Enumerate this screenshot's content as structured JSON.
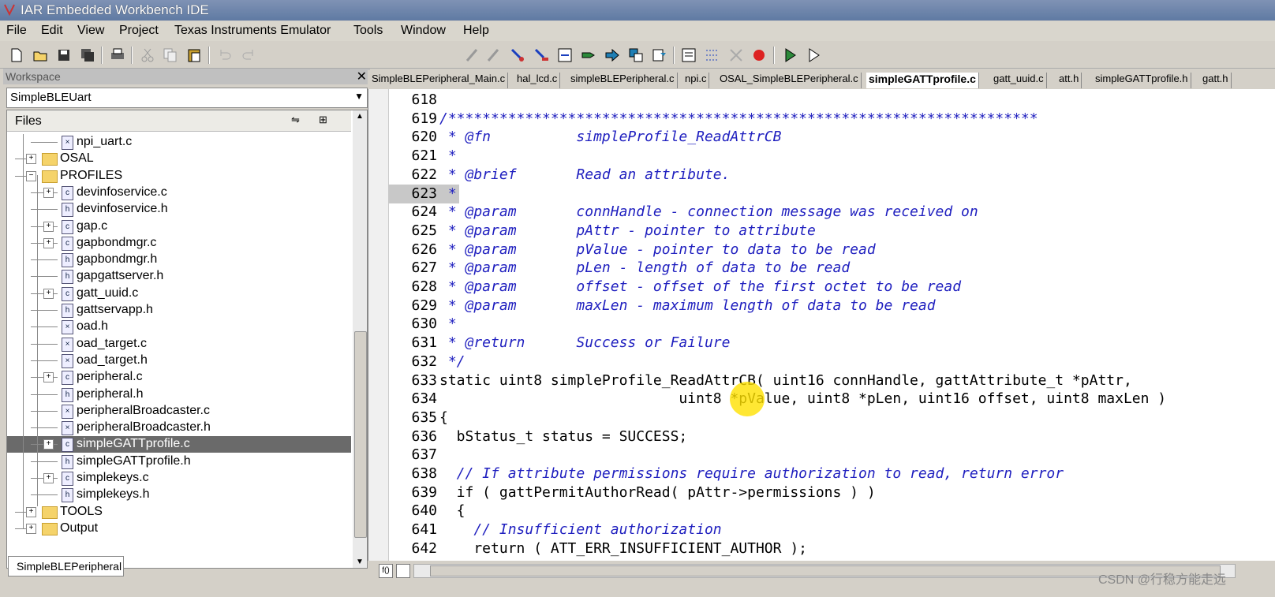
{
  "window": {
    "title": "IAR Embedded Workbench IDE"
  },
  "menu": [
    "File",
    "Edit",
    "View",
    "Project",
    "Texas Instruments Emulator",
    "Tools",
    "Window",
    "Help"
  ],
  "workspace": {
    "header": "Workspace",
    "project": "SimpleBLEUart",
    "files_label": "Files",
    "bottom_tab": "SimpleBLEPeripheral",
    "tree": [
      {
        "name": "npi_uart.c",
        "kind": "file-x"
      },
      {
        "name": "OSAL",
        "kind": "folder"
      },
      {
        "name": "PROFILES",
        "kind": "folder"
      },
      {
        "name": "devinfoservice.c",
        "kind": "file-c"
      },
      {
        "name": "devinfoservice.h",
        "kind": "file-h"
      },
      {
        "name": "gap.c",
        "kind": "file-c"
      },
      {
        "name": "gapbondmgr.c",
        "kind": "file-c"
      },
      {
        "name": "gapbondmgr.h",
        "kind": "file-h"
      },
      {
        "name": "gapgattserver.h",
        "kind": "file-h"
      },
      {
        "name": "gatt_uuid.c",
        "kind": "file-c"
      },
      {
        "name": "gattservapp.h",
        "kind": "file-h"
      },
      {
        "name": "oad.h",
        "kind": "file-x"
      },
      {
        "name": "oad_target.c",
        "kind": "file-x"
      },
      {
        "name": "oad_target.h",
        "kind": "file-x"
      },
      {
        "name": "peripheral.c",
        "kind": "file-c"
      },
      {
        "name": "peripheral.h",
        "kind": "file-h"
      },
      {
        "name": "peripheralBroadcaster.c",
        "kind": "file-x"
      },
      {
        "name": "peripheralBroadcaster.h",
        "kind": "file-x"
      },
      {
        "name": "simpleGATTprofile.c",
        "kind": "file-c",
        "selected": true
      },
      {
        "name": "simpleGATTprofile.h",
        "kind": "file-h"
      },
      {
        "name": "simplekeys.c",
        "kind": "file-c"
      },
      {
        "name": "simplekeys.h",
        "kind": "file-h"
      },
      {
        "name": "TOOLS",
        "kind": "folder"
      },
      {
        "name": "Output",
        "kind": "folder"
      }
    ]
  },
  "tabs": [
    "SimpleBLEPeripheral_Main.c",
    "hal_lcd.c",
    "simpleBLEPeripheral.c",
    "npi.c",
    "OSAL_SimpleBLEPeripheral.c",
    "simpleGATTprofile.c",
    "gatt_uuid.c",
    "att.h",
    "simpleGATTprofile.h",
    "gatt.h"
  ],
  "active_tab": "simpleGATTprofile.c",
  "code": [
    {
      "n": "618",
      "t": "",
      "s": "n"
    },
    {
      "n": "619",
      "t": "/*********************************************************************",
      "s": "cm"
    },
    {
      "n": "620",
      "t": " * @fn          simpleProfile_ReadAttrCB",
      "s": "cm"
    },
    {
      "n": "621",
      "t": " *",
      "s": "cm"
    },
    {
      "n": "622",
      "t": " * @brief       Read an attribute.",
      "s": "cm"
    },
    {
      "n": "623",
      "t": " *",
      "s": "cm"
    },
    {
      "n": "624",
      "t": " * @param       connHandle - connection message was received on",
      "s": "cm"
    },
    {
      "n": "625",
      "t": " * @param       pAttr - pointer to attribute",
      "s": "cm"
    },
    {
      "n": "626",
      "t": " * @param       pValue - pointer to data to be read",
      "s": "cm"
    },
    {
      "n": "627",
      "t": " * @param       pLen - length of data to be read",
      "s": "cm"
    },
    {
      "n": "628",
      "t": " * @param       offset - offset of the first octet to be read",
      "s": "cm"
    },
    {
      "n": "629",
      "t": " * @param       maxLen - maximum length of data to be read",
      "s": "cm"
    },
    {
      "n": "630",
      "t": " *",
      "s": "cm"
    },
    {
      "n": "631",
      "t": " * @return      Success or Failure",
      "s": "cm"
    },
    {
      "n": "632",
      "t": " */",
      "s": "cm"
    },
    {
      "n": "633",
      "t": "static uint8 simpleProfile_ReadAttrCB( uint16 connHandle, gattAttribute_t *pAttr,",
      "s": "kw"
    },
    {
      "n": "634",
      "t": "                            uint8 *pValue, uint8 *pLen, uint16 offset, uint8 maxLen )",
      "s": "n"
    },
    {
      "n": "635",
      "t": "{",
      "s": "n"
    },
    {
      "n": "636",
      "t": "  bStatus_t status = SUCCESS;",
      "s": "n"
    },
    {
      "n": "637",
      "t": "",
      "s": "n"
    },
    {
      "n": "638",
      "t": "  // If attribute permissions require authorization to read, return error",
      "s": "cm"
    },
    {
      "n": "639",
      "t": "  if ( gattPermitAuthorRead( pAttr->permissions ) )",
      "s": "kw"
    },
    {
      "n": "640",
      "t": "  {",
      "s": "n"
    },
    {
      "n": "641",
      "t": "    // Insufficient authorization",
      "s": "cm"
    },
    {
      "n": "642",
      "t": "    return ( ATT_ERR_INSUFFICIENT_AUTHOR );",
      "s": "kw"
    }
  ],
  "watermark": "CSDN @行稳方能走远"
}
